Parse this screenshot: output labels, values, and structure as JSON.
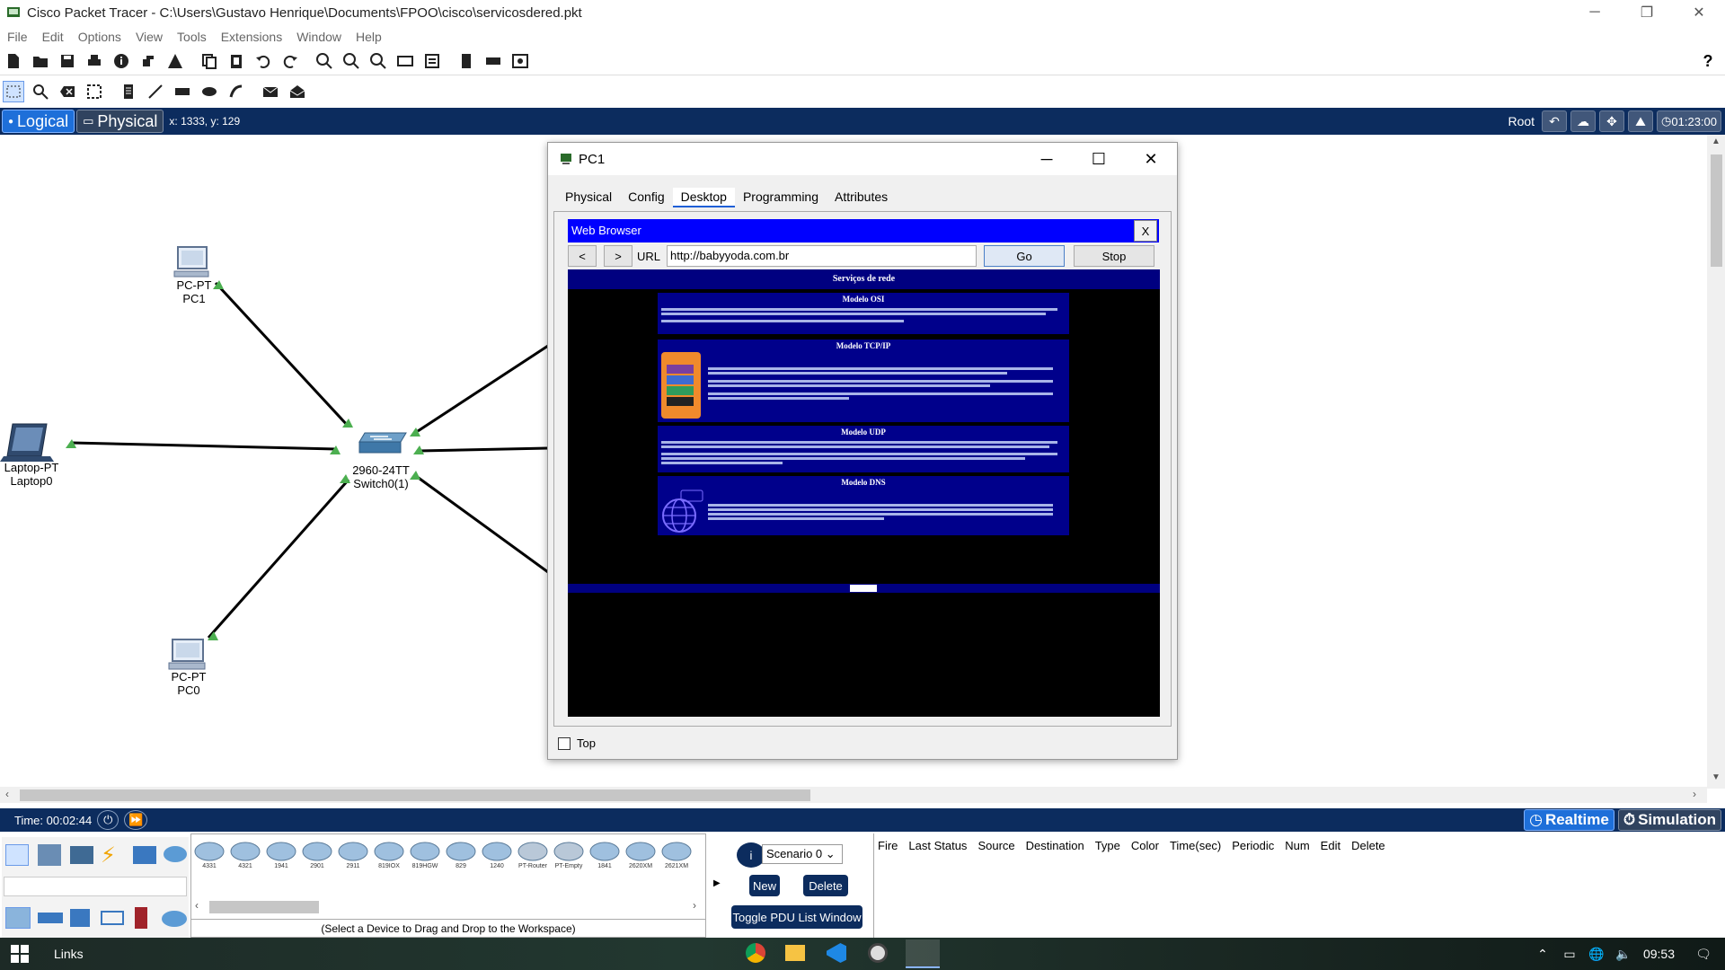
{
  "window": {
    "title": "Cisco Packet Tracer - C:\\Users\\Gustavo Henrique\\Documents\\FPOO\\cisco\\servicosdered.pkt",
    "controls": [
      "─",
      "❐",
      "✕"
    ]
  },
  "menu": [
    "File",
    "Edit",
    "Options",
    "View",
    "Tools",
    "Extensions",
    "Window",
    "Help"
  ],
  "help_glyph": "?",
  "logical_bar": {
    "logical_label": "Logical",
    "physical_label": "Physical",
    "coords": "x: 1333, y: 129",
    "root_label": "Root",
    "clock": "01:23:00"
  },
  "devices": {
    "pc1": {
      "type": "PC-PT",
      "name": "PC1"
    },
    "pc0": {
      "type": "PC-PT",
      "name": "PC0"
    },
    "laptop0": {
      "type": "Laptop-PT",
      "name": "Laptop0"
    },
    "switch0": {
      "type": "2960-24TT",
      "name": "Switch0(1)"
    }
  },
  "pc_window": {
    "title": "PC1",
    "tabs": [
      "Physical",
      "Config",
      "Desktop",
      "Programming",
      "Attributes"
    ],
    "active_tab": "Desktop",
    "top_checkbox_label": "Top"
  },
  "browser": {
    "title": "Web Browser",
    "close_label": "X",
    "back_label": "<",
    "forward_label": ">",
    "url_label": "URL",
    "url_value": "http://babyyoda.com.br",
    "go_label": "Go",
    "stop_label": "Stop",
    "page_header": "Serviços de rede",
    "sections": [
      {
        "title": "Modelo OSI"
      },
      {
        "title": "Modelo TCP/IP"
      },
      {
        "title": "Modelo UDP"
      },
      {
        "title": "Modelo DNS"
      }
    ]
  },
  "sim_bar": {
    "time_label": "Time: 00:02:44",
    "realtime_label": "Realtime",
    "simulation_label": "Simulation"
  },
  "device_list": {
    "tiles": [
      "4331",
      "4321",
      "1941",
      "2901",
      "2911",
      "819IOX",
      "819HGW",
      "829",
      "1240",
      "PT-Router",
      "PT-Empty",
      "1841",
      "2620XM",
      "2621XM"
    ],
    "hint": "(Select a Device to Drag and Drop to the Workspace)"
  },
  "pdu_panel": {
    "scenario": "Scenario 0",
    "new_label": "New",
    "delete_label": "Delete",
    "toggle_label": "Toggle PDU List Window",
    "columns": [
      "Fire",
      "Last Status",
      "Source",
      "Destination",
      "Type",
      "Color",
      "Time(sec)",
      "Periodic",
      "Num",
      "Edit",
      "Delete"
    ]
  },
  "taskbar": {
    "links_label": "Links",
    "time": "09:53"
  },
  "colors": {
    "navy_bar": "#0c2c5e",
    "accent_blue": "#1e6fd9",
    "browser_title": "#0000ff",
    "link_green": "#4caf50"
  }
}
